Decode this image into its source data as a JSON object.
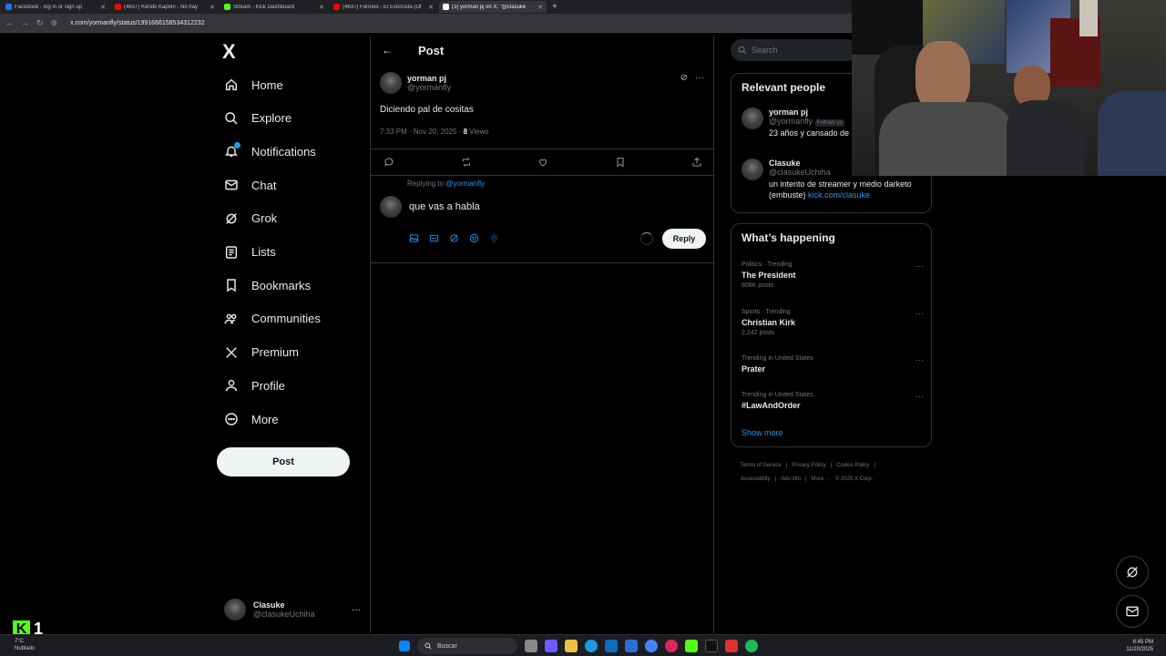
{
  "browser": {
    "tabs": [
      {
        "title": "Facebook - log in or sign up",
        "color": "#1877f2"
      },
      {
        "title": "(4637) Kendo Kaponi - No hay",
        "color": "#ff0000"
      },
      {
        "title": "Stream - Kick Dashboard",
        "color": "#53fc18"
      },
      {
        "title": "(4637) Farruko - El Exorcista (Of",
        "color": "#ff0000"
      },
      {
        "title": "(3) yorman pj on X: \"@clasuke",
        "color": "#ffffff"
      }
    ],
    "new_tab": "+",
    "url": "x.com/yormanfly/status/1991666158534312232"
  },
  "nav": {
    "logo": "X",
    "items": [
      {
        "label": "Home",
        "icon": "home-icon"
      },
      {
        "label": "Explore",
        "icon": "search-icon"
      },
      {
        "label": "Notifications",
        "icon": "bell-icon"
      },
      {
        "label": "Chat",
        "icon": "mail-icon"
      },
      {
        "label": "Grok",
        "icon": "grok-icon"
      },
      {
        "label": "Lists",
        "icon": "lists-icon"
      },
      {
        "label": "Bookmarks",
        "icon": "bookmark-icon"
      },
      {
        "label": "Communities",
        "icon": "communities-icon"
      },
      {
        "label": "Premium",
        "icon": "x-premium-icon"
      },
      {
        "label": "Profile",
        "icon": "profile-icon"
      },
      {
        "label": "More",
        "icon": "more-circle-icon"
      }
    ],
    "post_label": "Post",
    "account": {
      "name": "Clasuke",
      "handle": "@clasukeUchiha",
      "more": "···"
    }
  },
  "main": {
    "header_title": "Post",
    "post": {
      "author_name": "yorman pj",
      "author_handle": "@yormanfly",
      "text": "Diciendo pal de cositas",
      "timestamp": "7:33 PM · Nov 20, 2025 · ",
      "views_count": "8",
      "views_label": " Views"
    },
    "replying_prefix": "Replying to ",
    "replying_handle": "@yormanfly",
    "reply_text": "que vas a habla",
    "reply_button": "Reply"
  },
  "right": {
    "search_placeholder": "Search",
    "relevant_title": "Relevant people",
    "people": [
      {
        "name": "yorman pj",
        "handle": "@yormanfly",
        "badge": "Follows yo",
        "bio": "23 años y cansado de",
        "link": ""
      },
      {
        "name": "Clasuke",
        "handle": "@clasukeUchiha",
        "badge": "",
        "bio": "un intento de streamer y medio darketo (embuste) ",
        "link": "kick.com/clasuke"
      }
    ],
    "happening_title": "What’s happening",
    "trends": [
      {
        "context": "Politics · Trending",
        "name": "The President",
        "count": "808K posts"
      },
      {
        "context": "Sports · Trending",
        "name": "Christian Kirk",
        "count": "2,242 posts"
      },
      {
        "context": "Trending in United States",
        "name": "Prater",
        "count": ""
      },
      {
        "context": "Trending in United States",
        "name": "#LawAndOrder",
        "count": ""
      }
    ],
    "show_more": "Show more",
    "footer": [
      "Terms of Service",
      "|",
      "Privacy Policy",
      "|",
      "Cookie Policy",
      "|",
      "Accessibility",
      "|",
      "Ads info",
      "|",
      "More ···",
      "© 2025 X Corp."
    ]
  },
  "overlay": {
    "kick_letter": "K",
    "viewer_count": "1"
  },
  "taskbar": {
    "weather_temp": "7°C",
    "weather_desc": "Nublado",
    "search_label": "Buscar",
    "time": "8:45 PM",
    "date": "11/20/2025"
  }
}
